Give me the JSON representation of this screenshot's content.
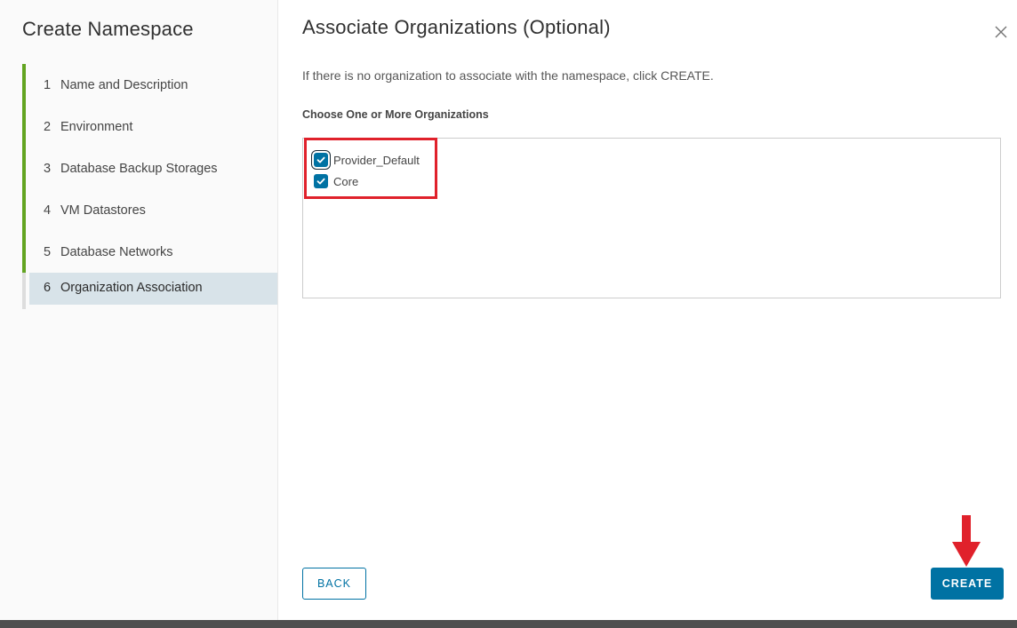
{
  "wizard": {
    "title": "Create Namespace",
    "steps": [
      {
        "num": "1",
        "label": "Name and Description",
        "status": "complete"
      },
      {
        "num": "2",
        "label": "Environment",
        "status": "complete"
      },
      {
        "num": "3",
        "label": "Database Backup Storages",
        "status": "complete"
      },
      {
        "num": "4",
        "label": "VM Datastores",
        "status": "complete"
      },
      {
        "num": "5",
        "label": "Database Networks",
        "status": "complete"
      },
      {
        "num": "6",
        "label": "Organization Association",
        "status": "active"
      }
    ]
  },
  "main": {
    "title": "Associate Organizations (Optional)",
    "info": "If there is no organization to associate with the namespace, click CREATE.",
    "choose_label": "Choose One or More Organizations",
    "organizations": [
      {
        "name": "Provider_Default",
        "checked": true
      },
      {
        "name": "Core",
        "checked": true
      }
    ]
  },
  "footer": {
    "back_label": "BACK",
    "create_label": "CREATE"
  },
  "colors": {
    "accent": "#0072a3",
    "step_complete": "#62a420",
    "step_active_bg": "#d8e3e9",
    "annotation_red": "#e0212b"
  },
  "icons": {
    "close": "close-icon",
    "checkbox": "checkmark-icon",
    "annotation": "red-arrow-down-icon"
  }
}
